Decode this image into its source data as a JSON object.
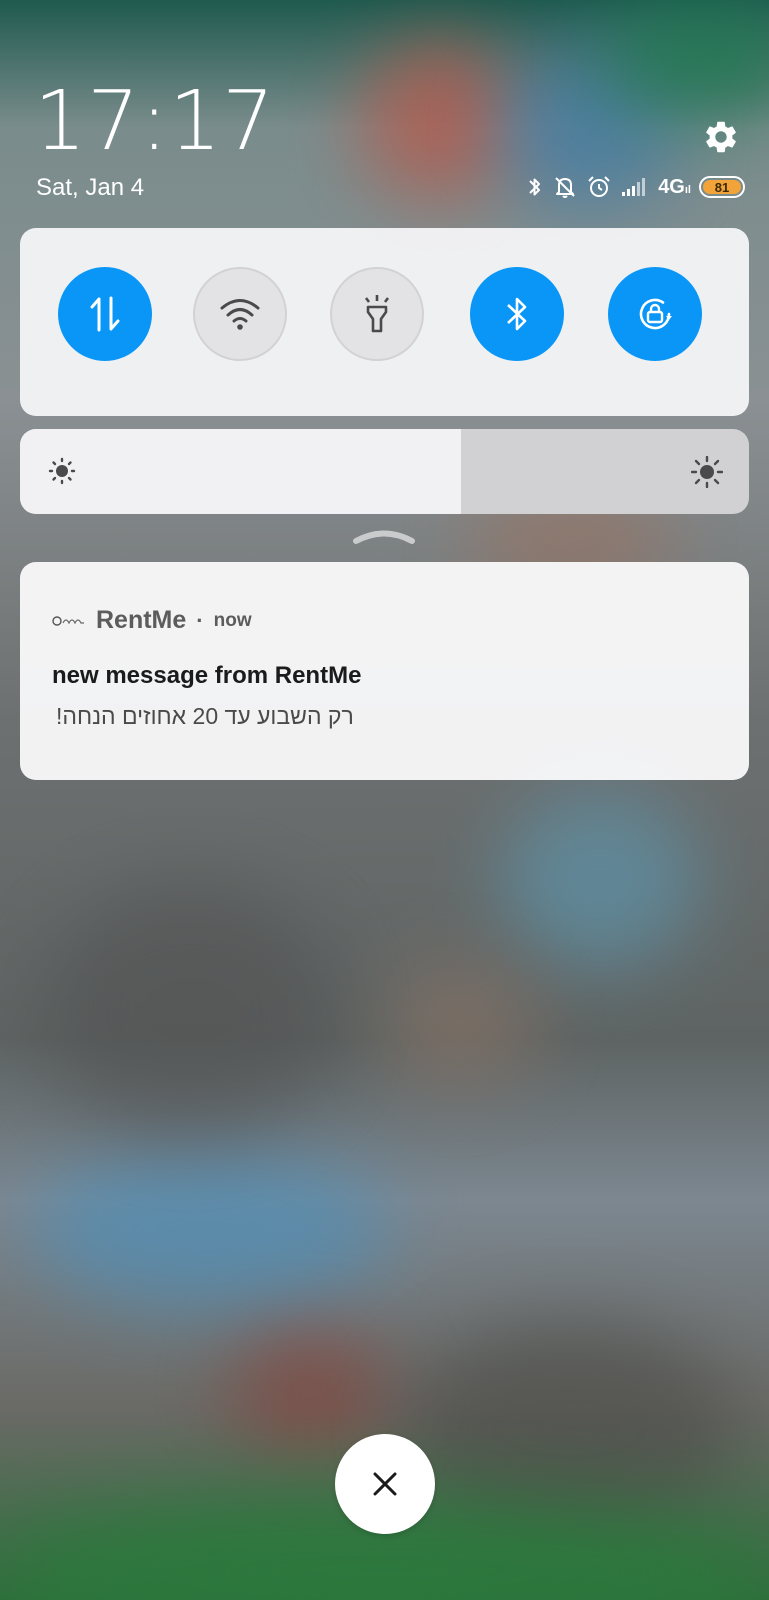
{
  "header": {
    "time": "17:17",
    "date": "Sat, Jan 4",
    "settings_icon": "gear-icon"
  },
  "status_bar": {
    "icons": [
      "bluetooth-icon",
      "silent-bell-icon",
      "alarm-icon",
      "signal-icon"
    ],
    "network": "4G",
    "network_sub": "ıl",
    "battery": "81",
    "battery_color": "#f2a33a"
  },
  "quick_toggles": [
    {
      "name": "mobile-data",
      "icon": "mobile-data-icon",
      "state": "on"
    },
    {
      "name": "wifi",
      "icon": "wifi-icon",
      "state": "off"
    },
    {
      "name": "flashlight",
      "icon": "flashlight-icon",
      "state": "off"
    },
    {
      "name": "bluetooth",
      "icon": "bluetooth-icon",
      "state": "on"
    },
    {
      "name": "auto-rotate-lock",
      "icon": "rotate-lock-icon",
      "state": "on"
    }
  ],
  "accent_color": "#0a96f6",
  "brightness": {
    "level": 0.605,
    "low_icon": "brightness-low-icon",
    "high_icon": "brightness-high-icon"
  },
  "notification": {
    "app_name": "RentMe",
    "separator": "·",
    "time": "now",
    "title": "new message from RentMe",
    "body": "רק השבוע עד 20 אחוזים הנחה!"
  },
  "close_icon": "close-icon"
}
